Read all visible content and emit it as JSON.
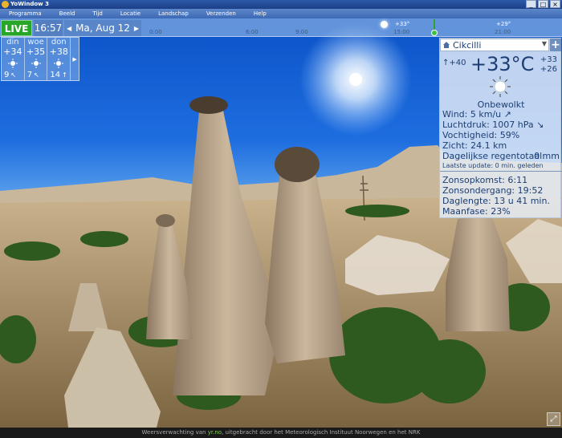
{
  "window": {
    "title": "YoWindow 3",
    "minimize": "_",
    "maximize": "□",
    "close": "×"
  },
  "menu": [
    "Programma",
    "Beeld",
    "Tijd",
    "Locatie",
    "Landschap",
    "Verzenden",
    "Help"
  ],
  "topbar": {
    "live_label": "LIVE",
    "time": "16:57",
    "date": "Ma, Aug 12",
    "prev_icon": "triangle-left-icon",
    "next_icon": "triangle-right-icon"
  },
  "timeline": {
    "ticks": [
      "0:00",
      "6:00",
      "9:00",
      "15:00",
      "21:00"
    ],
    "temps": [
      "+33°",
      "+29°"
    ]
  },
  "forecast": [
    {
      "day": "din",
      "temp": "+34",
      "wind": "9"
    },
    {
      "day": "woe",
      "temp": "+35",
      "wind": "7"
    },
    {
      "day": "don",
      "temp": "+38",
      "wind": "14"
    }
  ],
  "forecast_more_icon": "triangle-right-icon",
  "panel": {
    "location": "Cikcilli",
    "add_label": "+",
    "feels_like": "+40",
    "temperature": "+33°C",
    "high": "+33",
    "low": "+26",
    "condition": "Onbewolkt",
    "wind_label": "Wind:",
    "wind_value": "5 km/u ↗",
    "pressure_label": "Luchtdruk:",
    "pressure_value": "1007 hPa ↘",
    "humidity_label": "Vochtigheid:",
    "humidity_value": "59%",
    "visibility_label": "Zicht:",
    "visibility_value": "24.1 km",
    "rain_label": "Dagelijkse regentotaal:",
    "rain_value": "0 mm",
    "updated": "Laatste update: 0 min. geleden",
    "sunrise_label": "Zonsopkomst:",
    "sunrise_value": "6:11",
    "sunset_label": "Zonsondergang:",
    "sunset_value": "19:52",
    "daylength_label": "Daglengte:",
    "daylength_value": "13 u 41 min.",
    "moon_label": "Maanfase:",
    "moon_value": "23%"
  },
  "statusbar": {
    "prefix": "Weersverwachting van",
    "source": "yr.no",
    "suffix": ", uitgebracht door het Meteorologisch Instituut Noorwegen en het NRK"
  },
  "icons": {
    "sun": "sun-icon",
    "home": "home-icon",
    "fullscreen": "fullscreen-icon",
    "wind_arrow": "arrow-up-right-icon"
  },
  "colors": {
    "live": "#27a627",
    "panel_text": "#1c3e73",
    "sky": "#1e6ee0"
  }
}
